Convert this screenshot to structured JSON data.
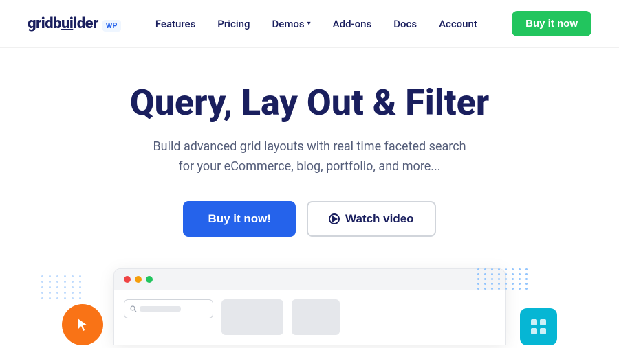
{
  "logo": {
    "text_main": "gridbuilder",
    "text_wp": "WP"
  },
  "nav": {
    "links": [
      {
        "label": "Features",
        "id": "features"
      },
      {
        "label": "Pricing",
        "id": "pricing"
      },
      {
        "label": "Demos",
        "id": "demos",
        "has_dropdown": true
      },
      {
        "label": "Add-ons",
        "id": "addons"
      },
      {
        "label": "Docs",
        "id": "docs"
      },
      {
        "label": "Account",
        "id": "account"
      }
    ],
    "buy_button": "Buy it now"
  },
  "hero": {
    "title": "Query, Lay Out & Filter",
    "subtitle_line1": "Build advanced grid layouts with real time faceted search",
    "subtitle_line2": "for your eCommerce, blog, portfolio, and more...",
    "btn_primary": "Buy it now!",
    "btn_secondary": "Watch video"
  },
  "preview": {
    "search_placeholder": "",
    "window_alt": "App preview"
  },
  "colors": {
    "primary_blue": "#2563eb",
    "green": "#22c55e",
    "dark_navy": "#1a1f5e",
    "orange": "#f97316",
    "cyan": "#06b6d4"
  }
}
